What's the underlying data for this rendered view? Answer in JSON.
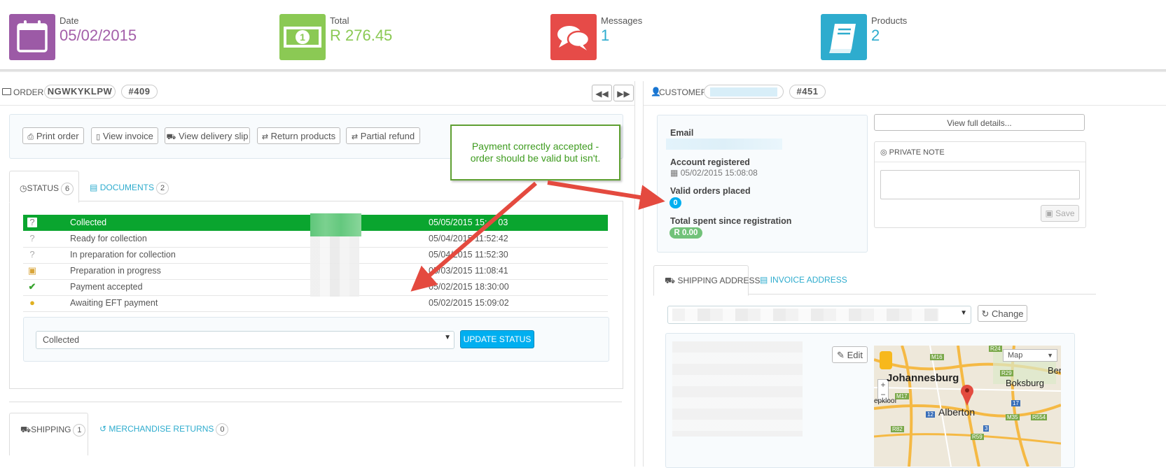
{
  "kpis": [
    {
      "label": "Date",
      "value": "05/02/2015",
      "color": "#a35ea9",
      "icon": "calendar-icon"
    },
    {
      "label": "Total",
      "value": "R 276.45",
      "color": "#8bc954",
      "icon": "banknote-icon"
    },
    {
      "label": "Messages",
      "value": "1",
      "color": "#2eacce",
      "icon": "chat-bubbles-icon"
    },
    {
      "label": "Products",
      "value": "2",
      "color": "#2eacce",
      "icon": "book-icon"
    }
  ],
  "kpi_bg_colors": {
    "date": "#9c5aa6",
    "total": "#8bc954",
    "messages": "#e64b48",
    "products": "#2eacce"
  },
  "order": {
    "title": "Order",
    "reference": "NGWKYKLPW",
    "id": "#409",
    "buttons": [
      "Print order",
      "View invoice",
      "View delivery slip",
      "Return products",
      "Partial refund"
    ],
    "tabs": {
      "status_label": "Status",
      "status_count": "6",
      "documents_label": "Documents",
      "documents_count": "2"
    },
    "history": [
      {
        "status": "Collected",
        "date": "05/05/2015 15:1?:03",
        "date_shown": "05/05/2015 15:",
        "date_tail": "03",
        "icon": "question-icon"
      },
      {
        "status": "Ready for collection",
        "date": "05/04/2015 11:52:42",
        "icon": "question-icon"
      },
      {
        "status": "In preparation for collection",
        "date": "05/04/2015 11:52:30",
        "icon": "question-icon"
      },
      {
        "status": "Preparation in progress",
        "date": "05/03/2015 11:08:41",
        "icon": "box-icon"
      },
      {
        "status": "Payment accepted",
        "date": "05/02/2015 18:30:00",
        "icon": "check-icon"
      },
      {
        "status": "Awaiting EFT payment",
        "date": "05/02/2015 15:09:02",
        "icon": "coins-icon"
      }
    ],
    "status_select_value": "Collected",
    "update_status_label": "UPDATE STATUS",
    "shipping_tab": {
      "label": "Shipping",
      "count": "1"
    },
    "returns_tab": {
      "label": "Merchandise Returns",
      "count": "0"
    }
  },
  "annotation": {
    "text": "Payment correctly accepted - order should be valid but isn't.",
    "text_line1": "Payment correctly accepted -",
    "text_line2": "order should be valid but isn't.",
    "border_color": "#5fa033",
    "text_color": "#3e9b1f",
    "arrow_color": "#e44a3f"
  },
  "customer": {
    "title": "Customer",
    "id": "#451",
    "email_label": "Email",
    "account_registered_label": "Account registered",
    "account_registered_value": "05/02/2015 15:08:08",
    "valid_orders_label": "Valid orders placed",
    "valid_orders_value": "0",
    "total_spent_label": "Total spent since registration",
    "total_spent_value": "R 0.00",
    "view_details_label": "View full details...",
    "private_note_label": "Private Note",
    "save_label": "Save",
    "shipping_address_tab": "Shipping Address",
    "invoice_address_tab": "Invoice Address",
    "change_label": "Change",
    "edit_label": "Edit",
    "map": {
      "type_label": "Map",
      "city_labels": [
        "Johannesburg",
        "Boksburg",
        "Alberton",
        "Ber",
        "epkloof"
      ],
      "route_labels": [
        "R24",
        "M16",
        "R29",
        "M17",
        "12",
        "17",
        "R82",
        "M35",
        "R554",
        "3",
        "R59"
      ]
    }
  }
}
